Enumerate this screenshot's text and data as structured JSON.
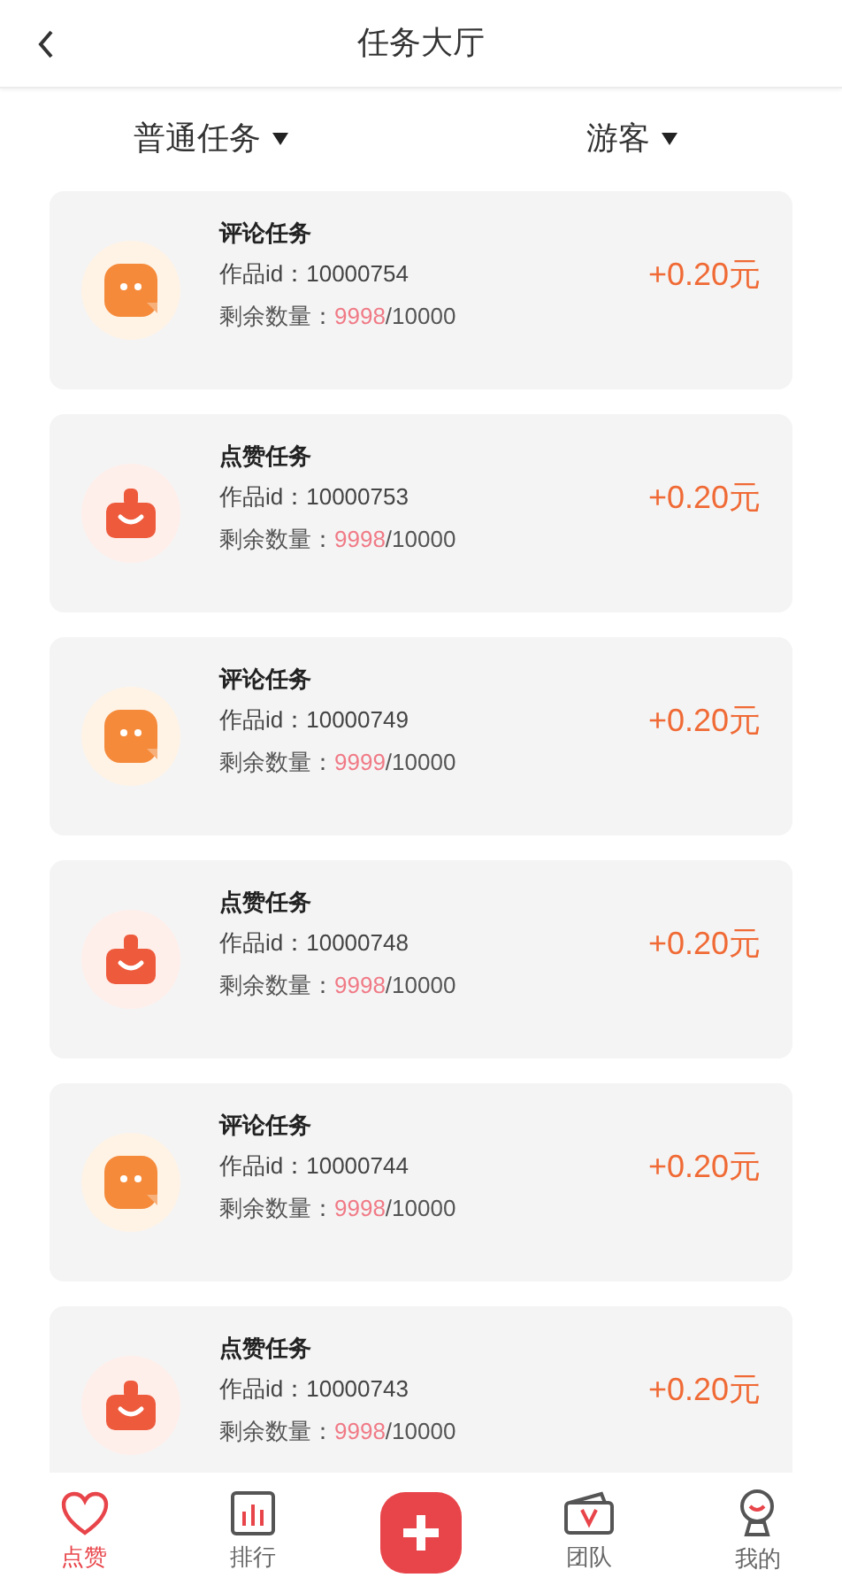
{
  "header": {
    "title": "任务大厅"
  },
  "filters": [
    {
      "label": "普通任务"
    },
    {
      "label": "游客"
    }
  ],
  "tasks": [
    {
      "kind": "comment",
      "title": "评论任务",
      "id_label": "作品id：10000754",
      "remaining_label": "剩余数量：",
      "remaining": "9998",
      "total": "/10000",
      "reward": "+0.20元"
    },
    {
      "kind": "like",
      "title": "点赞任务",
      "id_label": "作品id：10000753",
      "remaining_label": "剩余数量：",
      "remaining": "9998",
      "total": "/10000",
      "reward": "+0.20元"
    },
    {
      "kind": "comment",
      "title": "评论任务",
      "id_label": "作品id：10000749",
      "remaining_label": "剩余数量：",
      "remaining": "9999",
      "total": "/10000",
      "reward": "+0.20元"
    },
    {
      "kind": "like",
      "title": "点赞任务",
      "id_label": "作品id：10000748",
      "remaining_label": "剩余数量：",
      "remaining": "9998",
      "total": "/10000",
      "reward": "+0.20元"
    },
    {
      "kind": "comment",
      "title": "评论任务",
      "id_label": "作品id：10000744",
      "remaining_label": "剩余数量：",
      "remaining": "9998",
      "total": "/10000",
      "reward": "+0.20元"
    },
    {
      "kind": "like",
      "title": "点赞任务",
      "id_label": "作品id：10000743",
      "remaining_label": "剩余数量：",
      "remaining": "9998",
      "total": "/10000",
      "reward": "+0.20元"
    }
  ],
  "nav": [
    {
      "kind": "heart",
      "label": "点赞",
      "selected": true
    },
    {
      "kind": "chart",
      "label": "排行",
      "selected": false
    },
    {
      "kind": "plus"
    },
    {
      "kind": "tv",
      "label": "团队",
      "selected": false
    },
    {
      "kind": "person",
      "label": "我的",
      "selected": false
    }
  ]
}
